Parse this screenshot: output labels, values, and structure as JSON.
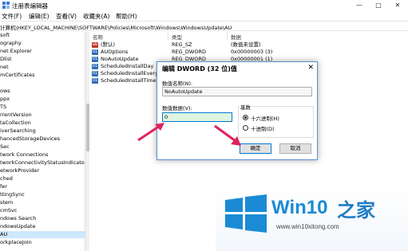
{
  "window": {
    "title": "注册表编辑器",
    "controls": [
      "—",
      "□",
      "✕"
    ]
  },
  "menu": [
    "文件(F)",
    "编辑(E)",
    "查看(V)",
    "收藏夹(A)",
    "帮助(H)"
  ],
  "address": "计算机\\HKEY_LOCAL_MACHINE\\SOFTWARE\\Policies\\Microsoft\\Windows\\WindowsUpdate\\AU",
  "tree": {
    "items": [
      "soft",
      "ography",
      "net Explorer",
      "Dlist",
      "net",
      "mCertificates",
      "",
      "ows",
      "ppx",
      "TS",
      "rrentVersion",
      "taCollection",
      "iverSearching",
      "hancedStorageDevices",
      "Sec",
      "twork Connections",
      "tworkConnectivityStatusIndicator",
      "etworkProvider",
      "ched",
      "fer",
      "ttingSync",
      "stem",
      "cmSvc",
      "ndows Search",
      "ndowsUpdate",
      "AU",
      "orkplaceJoin"
    ],
    "selected_index": 25
  },
  "list": {
    "columns": [
      "名称",
      "类型",
      "数据"
    ],
    "rows": [
      {
        "icon": "string-value-icon",
        "icon_text": "ab",
        "name": "(默认)",
        "type": "REG_SZ",
        "data": "(数值未设置)"
      },
      {
        "icon": "dword-value-icon",
        "icon_text": "01",
        "name": "AUOptions",
        "type": "REG_DWORD",
        "data": "0x00000003 (3)"
      },
      {
        "icon": "dword-value-icon",
        "icon_text": "01",
        "name": "NoAutoUpdate",
        "type": "REG_DWORD",
        "data": "0x00000001 (1)"
      },
      {
        "icon": "dword-value-icon",
        "icon_text": "01",
        "name": "ScheduledInstallDay",
        "type": "",
        "data": ""
      },
      {
        "icon": "dword-value-icon",
        "icon_text": "01",
        "name": "ScheduledInstallEveryWe",
        "type": "",
        "data": ""
      },
      {
        "icon": "dword-value-icon",
        "icon_text": "01",
        "name": "ScheduledInstallTime",
        "type": "",
        "data": ""
      }
    ]
  },
  "dialog": {
    "title": "编辑 DWORD (32 位)值",
    "close": "✕",
    "name_label": "数值名称(N):",
    "name_value": "NoAutoUpdate",
    "data_label": "数值数据(V):",
    "data_value": "0",
    "base_label": "基数",
    "base_options": [
      "十六进制(H)",
      "十进制(D)"
    ],
    "base_selected": 0,
    "ok_label": "确定",
    "cancel_label": "取消"
  },
  "brand": {
    "name": "Win10",
    "name_suffix": "之家",
    "url": "www.win10xitong.com",
    "colors": {
      "logo": "#1a8bd4",
      "text": "#1f7dc4"
    }
  },
  "annotation": {
    "arrow_color": "#e0245e"
  }
}
